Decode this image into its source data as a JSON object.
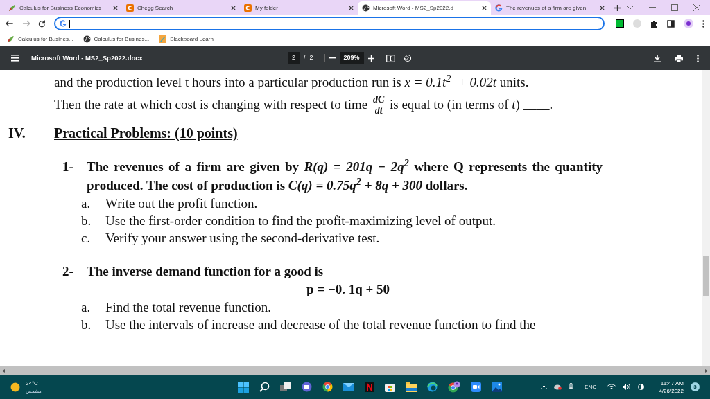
{
  "browser": {
    "tabs": [
      {
        "label": "Calculus for Business Economics",
        "selected": false
      },
      {
        "label": "Chegg Search",
        "selected": false
      },
      {
        "label": "My folder",
        "selected": false
      },
      {
        "label": "Microsoft Word - MS2_Sp2022.d",
        "selected": true
      },
      {
        "label": "The revenues of a firm are given",
        "selected": false
      }
    ],
    "bookmarks": [
      {
        "label": "Calculus for Busines..."
      },
      {
        "label": "Calculus for Busines..."
      },
      {
        "label": "Blackboard Learn"
      }
    ]
  },
  "pdf_toolbar": {
    "title": "Microsoft Word - MS2_Sp2022.docx",
    "page": "2",
    "page_separator": "/",
    "page_count": "2",
    "zoom": "209%"
  },
  "document": {
    "intro_lines": [
      [
        {
          "kind": "text",
          "text": "and the production level t hours into a particular production run is "
        },
        {
          "kind": "math",
          "text": "x = 0.1t$^{2}$  + 0.02t"
        },
        {
          "kind": "text",
          "text": " units."
        }
      ],
      [
        {
          "kind": "text",
          "text": "Then the rate at which cost is changing with respect to time "
        },
        {
          "kind": "fraction",
          "numerator": "dC",
          "denominator": "dt"
        },
        {
          "kind": "text",
          "text": " is equal to (in terms of "
        },
        {
          "kind": "math",
          "text": "t"
        },
        {
          "kind": "text",
          "text": ") ____."
        }
      ]
    ],
    "section": {
      "number": "IV.",
      "heading": "Practical Problems: (10 points)"
    },
    "problems": [
      {
        "number": "1-",
        "text": [
          {
            "kind": "text",
            "text": "The revenues of a firm are given by "
          },
          {
            "kind": "math",
            "text": "R(q) = 201q − 2q$^{2}$"
          },
          {
            "kind": "text",
            "text": " where Q represents the quantity produced. The cost of production is "
          },
          {
            "kind": "math",
            "text": "C(q) = 0.75q$^{2}$ + 8q + 300"
          },
          {
            "kind": "text",
            "text": " dollars."
          }
        ],
        "parts": [
          {
            "letter": "a.",
            "text": "Write out the profit function."
          },
          {
            "letter": "b.",
            "text": "Use the first-order condition to find the profit-maximizing level of output."
          },
          {
            "letter": "c.",
            "text": "Verify your answer using the second-derivative test."
          }
        ]
      },
      {
        "number": "2-",
        "text": [
          {
            "kind": "text",
            "text": "The inverse demand function for a good is"
          }
        ],
        "equation": "p = −0. 1q + 50",
        "parts": [
          {
            "letter": "a.",
            "text": "Find the total revenue function."
          },
          {
            "letter": "b.",
            "text": "Use the intervals of increase and decrease of the total revenue function to find the"
          }
        ]
      }
    ]
  },
  "taskbar": {
    "temperature": "24°C",
    "condition": "مشمس",
    "language": "ENG",
    "time": "11:47 AM",
    "date": "4/26/2022",
    "notification_count": "3"
  }
}
